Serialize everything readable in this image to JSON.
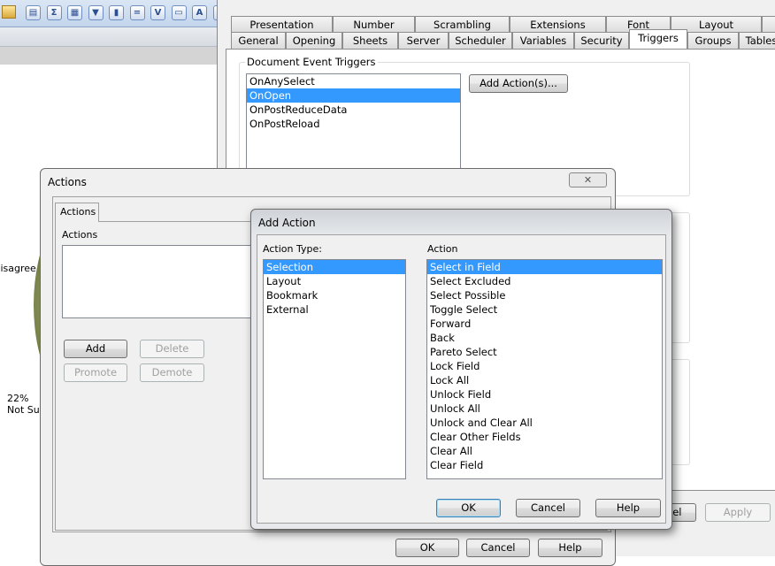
{
  "toolbar": {
    "icons": [
      "folder-icon",
      "list-box-icon",
      "sum-icon",
      "table-icon",
      "multibox-icon",
      "chart-icon",
      "input-box-icon",
      "checkmark-icon",
      "button-icon",
      "text-object-icon",
      "line-arrow-icon"
    ],
    "glyphs": [
      "▤",
      "Σ",
      "▦",
      "▼",
      "▮",
      "=",
      "V",
      "▭",
      "A",
      "⇉"
    ]
  },
  "background_chart": {
    "label_disagree": "Disagree",
    "pct_not_sure": "22%",
    "label_not_sure": "Not Sure"
  },
  "properties": {
    "tabs_row1": [
      "Presentation",
      "Number",
      "Scrambling",
      "Extensions",
      "Font",
      "Layout"
    ],
    "tabs_row2": [
      "General",
      "Opening",
      "Sheets",
      "Server",
      "Scheduler",
      "Variables",
      "Security",
      "Triggers",
      "Groups",
      "Tables"
    ],
    "selected_tab": "Triggers",
    "group_title": "Document Event Triggers",
    "events": [
      "OnAnySelect",
      "OnOpen",
      "OnPostReduceData",
      "OnPostReload"
    ],
    "selected_event": "OnOpen",
    "add_action_button": "Add Action(s)...",
    "cancel_button": "Cancel",
    "apply_button": "Apply"
  },
  "actions_dialog": {
    "title": "Actions",
    "tab": "Actions",
    "list_label": "Actions",
    "add": "Add",
    "delete": "Delete",
    "promote": "Promote",
    "demote": "Demote",
    "ok": "OK",
    "cancel": "Cancel",
    "help": "Help"
  },
  "add_action_dialog": {
    "title": "Add Action",
    "type_label": "Action Type:",
    "types": [
      "Selection",
      "Layout",
      "Bookmark",
      "External"
    ],
    "selected_type": "Selection",
    "action_label": "Action",
    "actions": [
      "Select in Field",
      "Select Excluded",
      "Select Possible",
      "Toggle Select",
      "Forward",
      "Back",
      "Pareto Select",
      "Lock Field",
      "Lock All",
      "Unlock Field",
      "Unlock All",
      "Unlock and Clear All",
      "Clear Other Fields",
      "Clear All",
      "Clear Field"
    ],
    "selected_action": "Select in Field",
    "ok": "OK",
    "cancel": "Cancel",
    "help": "Help"
  },
  "colors": {
    "selection": "#3399ff",
    "toolbar": "#c3d5ec"
  }
}
